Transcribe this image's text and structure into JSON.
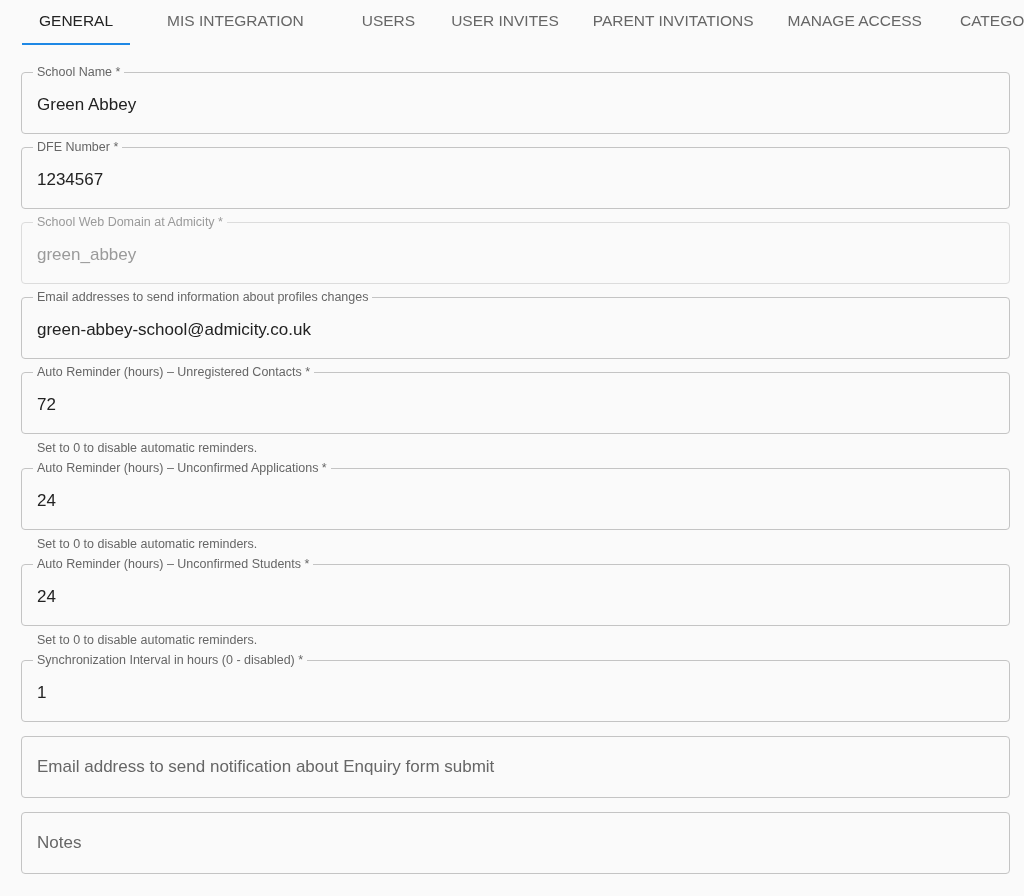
{
  "tabs": [
    {
      "label": "GENERAL",
      "selected": true
    },
    {
      "label": "MIS INTEGRATION",
      "selected": false
    },
    {
      "label": "USERS",
      "selected": false
    },
    {
      "label": "USER INVITES",
      "selected": false
    },
    {
      "label": "PARENT INVITATIONS",
      "selected": false
    },
    {
      "label": "MANAGE ACCESS",
      "selected": false
    },
    {
      "label": "CATEGO",
      "selected": false
    }
  ],
  "fields": [
    {
      "label": "School Name *",
      "value": "Green Abbey",
      "disabled": false
    },
    {
      "label": "DFE Number *",
      "value": "1234567",
      "disabled": false
    },
    {
      "label": "School Web Domain at Admicity *",
      "value": "green_abbey",
      "disabled": true
    },
    {
      "label": "Email addresses to send information about profiles changes",
      "value": "green-abbey-school@admicity.co.uk",
      "disabled": false
    },
    {
      "label": "Auto Reminder (hours) – Unregistered Contacts *",
      "value": "72",
      "disabled": false,
      "helper": "Set to 0 to disable automatic reminders."
    },
    {
      "label": "Auto Reminder (hours) – Unconfirmed Applications *",
      "value": "24",
      "disabled": false,
      "helper": "Set to 0 to disable automatic reminders."
    },
    {
      "label": "Auto Reminder (hours) – Unconfirmed Students *",
      "value": "24",
      "disabled": false,
      "helper": "Set to 0 to disable automatic reminders."
    },
    {
      "label": "Synchronization Interval in hours (0 - disabled) *",
      "value": "1",
      "disabled": false
    },
    {
      "placeholder": "Email address to send notification about Enquiry form submit",
      "disabled": false
    },
    {
      "placeholder": "Notes",
      "disabled": false
    }
  ]
}
